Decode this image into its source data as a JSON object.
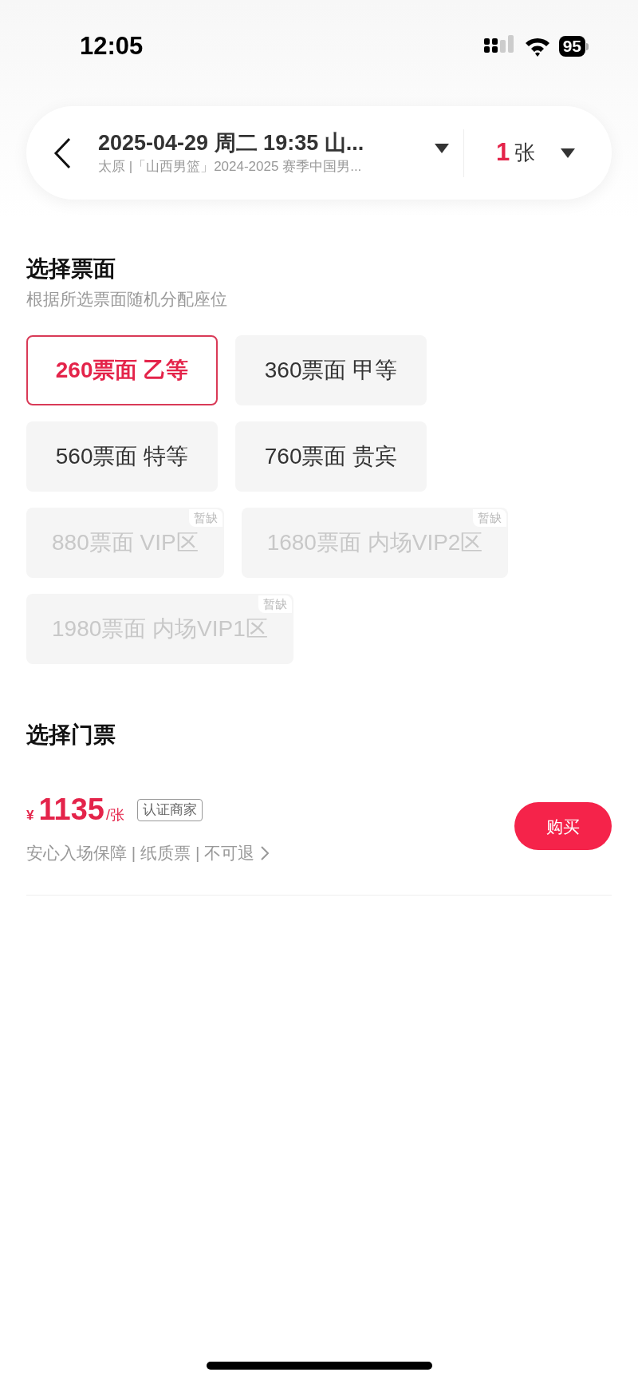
{
  "status_bar": {
    "time": "12:05",
    "battery": "95"
  },
  "header": {
    "title": "2025-04-29 周二 19:35 山...",
    "subtitle": "太原 |「山西男篮」2024-2025 赛季中国男...",
    "quantity": "1",
    "quantity_unit": "张"
  },
  "price_section": {
    "title": "选择票面",
    "subtitle": "根据所选票面随机分配座位",
    "options": [
      {
        "label": "260票面 乙等",
        "selected": true,
        "disabled": false
      },
      {
        "label": "360票面 甲等",
        "selected": false,
        "disabled": false
      },
      {
        "label": "560票面 特等",
        "selected": false,
        "disabled": false
      },
      {
        "label": "760票面 贵宾",
        "selected": false,
        "disabled": false
      },
      {
        "label": "880票面 VIP区",
        "selected": false,
        "disabled": true,
        "badge": "暂缺"
      },
      {
        "label": "1680票面 内场VIP2区",
        "selected": false,
        "disabled": true,
        "badge": "暂缺"
      },
      {
        "label": "1980票面 内场VIP1区",
        "selected": false,
        "disabled": true,
        "badge": "暂缺"
      }
    ]
  },
  "ticket_section": {
    "title": "选择门票",
    "tickets": [
      {
        "currency": "¥",
        "price": "1135",
        "unit": "/张",
        "tag": "认证商家",
        "features": "安心入场保障 | 纸质票 | 不可退",
        "button": "购买"
      }
    ]
  }
}
